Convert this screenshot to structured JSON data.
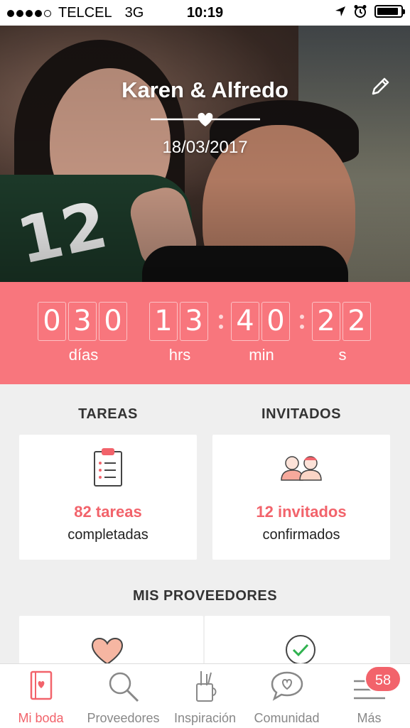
{
  "status_bar": {
    "carrier": "TELCEL",
    "network": "3G",
    "time": "10:19"
  },
  "header": {
    "couple_name": "Karen & Alfredo",
    "date": "18/03/2017"
  },
  "countdown": {
    "days": [
      "0",
      "3",
      "0"
    ],
    "hours": [
      "1",
      "3"
    ],
    "minutes": [
      "4",
      "0"
    ],
    "seconds": [
      "2",
      "2"
    ],
    "labels": {
      "days": "días",
      "hours": "hrs",
      "minutes": "min",
      "seconds": "s"
    }
  },
  "tasks": {
    "title": "TAREAS",
    "count": "82 tareas",
    "status": "completadas"
  },
  "guests": {
    "title": "INVITADOS",
    "count": "12 invitados",
    "status": "confirmados"
  },
  "providers": {
    "title": "MIS PROVEEDORES"
  },
  "tabbar": {
    "items": [
      {
        "label": "Mi boda",
        "icon": "notebook-icon"
      },
      {
        "label": "Proveedores",
        "icon": "search-icon"
      },
      {
        "label": "Inspiración",
        "icon": "art-supplies-icon"
      },
      {
        "label": "Comunidad",
        "icon": "chat-heart-icon"
      },
      {
        "label": "Más",
        "icon": "menu-icon"
      }
    ],
    "badge": "58"
  },
  "colors": {
    "accent": "#f2636b",
    "countdown_bg": "#f8767d"
  }
}
